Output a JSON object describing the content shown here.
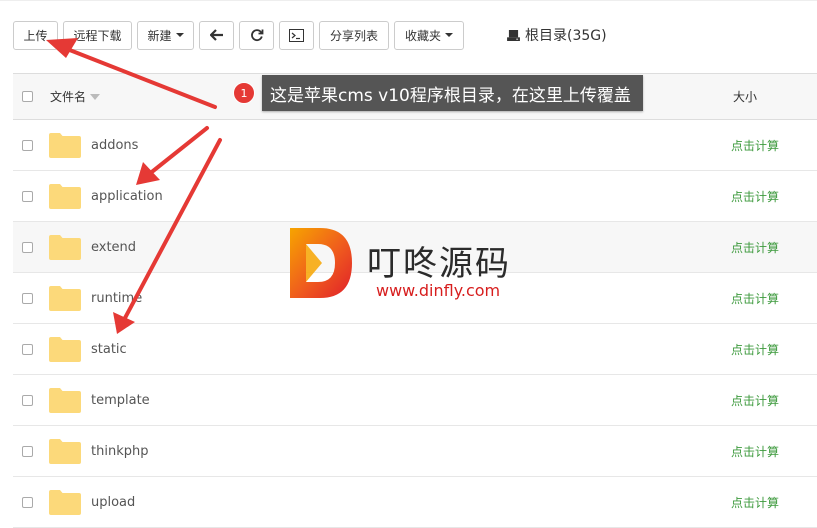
{
  "toolbar": {
    "upload_label": "上传",
    "remote_download_label": "远程下载",
    "new_label": "新建",
    "share_list_label": "分享列表",
    "favorites_label": "收藏夹",
    "root_label": "根目录(35G)"
  },
  "table": {
    "header": {
      "name": "文件名",
      "size": "大小"
    },
    "rows": [
      {
        "name": "addons",
        "size_action": "点击计算"
      },
      {
        "name": "application",
        "size_action": "点击计算"
      },
      {
        "name": "extend",
        "size_action": "点击计算"
      },
      {
        "name": "runtime",
        "size_action": "点击计算"
      },
      {
        "name": "static",
        "size_action": "点击计算"
      },
      {
        "name": "template",
        "size_action": "点击计算"
      },
      {
        "name": "thinkphp",
        "size_action": "点击计算"
      },
      {
        "name": "upload",
        "size_action": "点击计算"
      }
    ]
  },
  "annotation": {
    "badge": "1",
    "text": "这是苹果cms v10程序根目录，在这里上传覆盖"
  },
  "watermark": {
    "title": "叮咚源码",
    "url": "www.dinfly.com"
  },
  "colors": {
    "accent_green": "#3d9a3d",
    "arrow_red": "#e53935",
    "annotation_bg": "#555555",
    "folder_yellow": "#fcd97a"
  },
  "icons": [
    "arrow-left-icon",
    "refresh-icon",
    "terminal-icon",
    "drive-icon",
    "folder-icon"
  ]
}
